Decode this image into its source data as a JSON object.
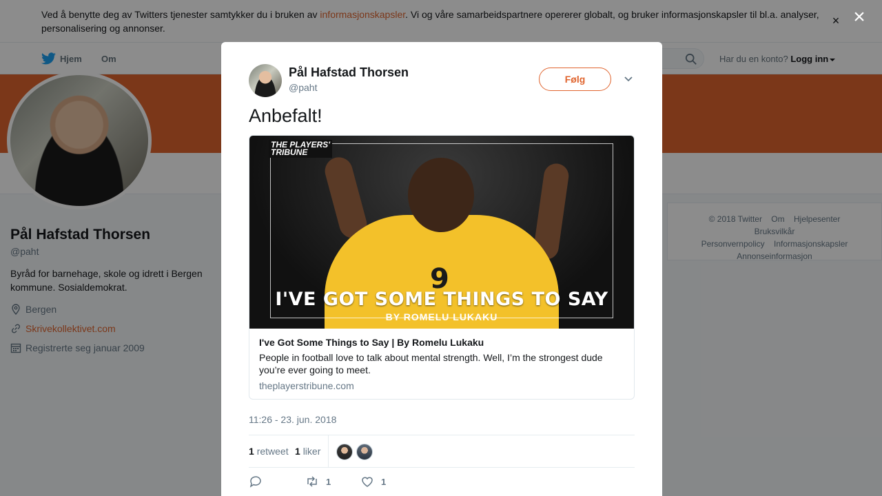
{
  "cookie": {
    "text_before": "Ved å benytte deg av Twitters tjenester samtykker du i bruken av ",
    "link": "informasjonskapsler",
    "text_after": ". Vi og våre samarbeidspartnere opererer globalt, og bruker informasjonskapsler til bl.a. analyser, personalisering og annonser.",
    "close": "×"
  },
  "nav": {
    "home": "Hjem",
    "about": "Om",
    "login_prompt": "Har du en konto?",
    "login": "Logg inn"
  },
  "profile": {
    "name": "Pål Hafstad Thorsen",
    "handle": "@paht",
    "bio": "Byråd for barnehage, skole og idrett i Bergen kommune. Sosialdemokrat.",
    "location": "Bergen",
    "url": "Skrivekollektivet.com",
    "joined": "Registrerte seg januar 2009"
  },
  "footer": {
    "items": [
      "© 2018 Twitter",
      "Om",
      "Hjelpesenter",
      "Bruksvilkår",
      "Personvernpolicy",
      "Informasjonskapsler",
      "Annonseinformasjon"
    ]
  },
  "overlay": {
    "close": "×"
  },
  "tweet": {
    "author_name": "Pål Hafstad Thorsen",
    "author_handle": "@paht",
    "follow_label": "Følg",
    "text": "Anbefalt!",
    "card": {
      "brand_top": "THE PLAYERS'",
      "brand_bottom": "TRIBUNE",
      "image_headline": "I'VE GOT SOME THINGS TO SAY",
      "image_sub": "BY ROMELU LUKAKU",
      "jersey_number": "9",
      "title": "I've Got Some Things to Say | By Romelu Lukaku",
      "description": "People in football love to talk about mental strength. Well, I’m the strongest dude you’re ever going to meet.",
      "domain": "theplayerstribune.com"
    },
    "timestamp": "11:26 - 23. jun. 2018",
    "retweets_count": "1",
    "retweets_label": "retweet",
    "likes_count": "1",
    "likes_label": "liker",
    "action_retweet_count": "1",
    "action_like_count": "1"
  },
  "colors": {
    "accent": "#e0652f",
    "text": "#14171a",
    "muted": "#657786"
  }
}
